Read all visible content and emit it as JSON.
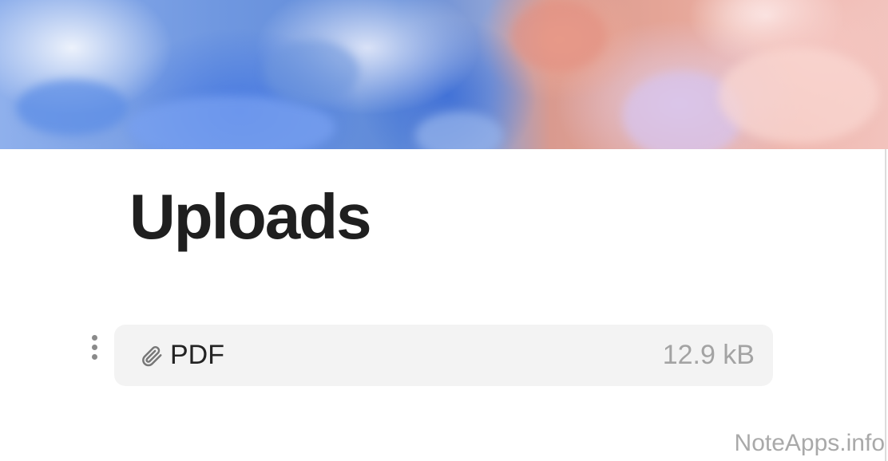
{
  "page": {
    "title": "Uploads"
  },
  "cover": {
    "icon": "cover-image"
  },
  "attachment": {
    "icon": "paperclip-icon",
    "name": "PDF",
    "size": "12.9 kB"
  },
  "block_handle": {
    "icon": "vertical-dots-icon"
  },
  "watermark": {
    "text": "NoteApps.info"
  },
  "colors": {
    "title": "#1f1f1f",
    "block_background": "#f3f3f3",
    "muted_text": "#a3a3a3"
  }
}
